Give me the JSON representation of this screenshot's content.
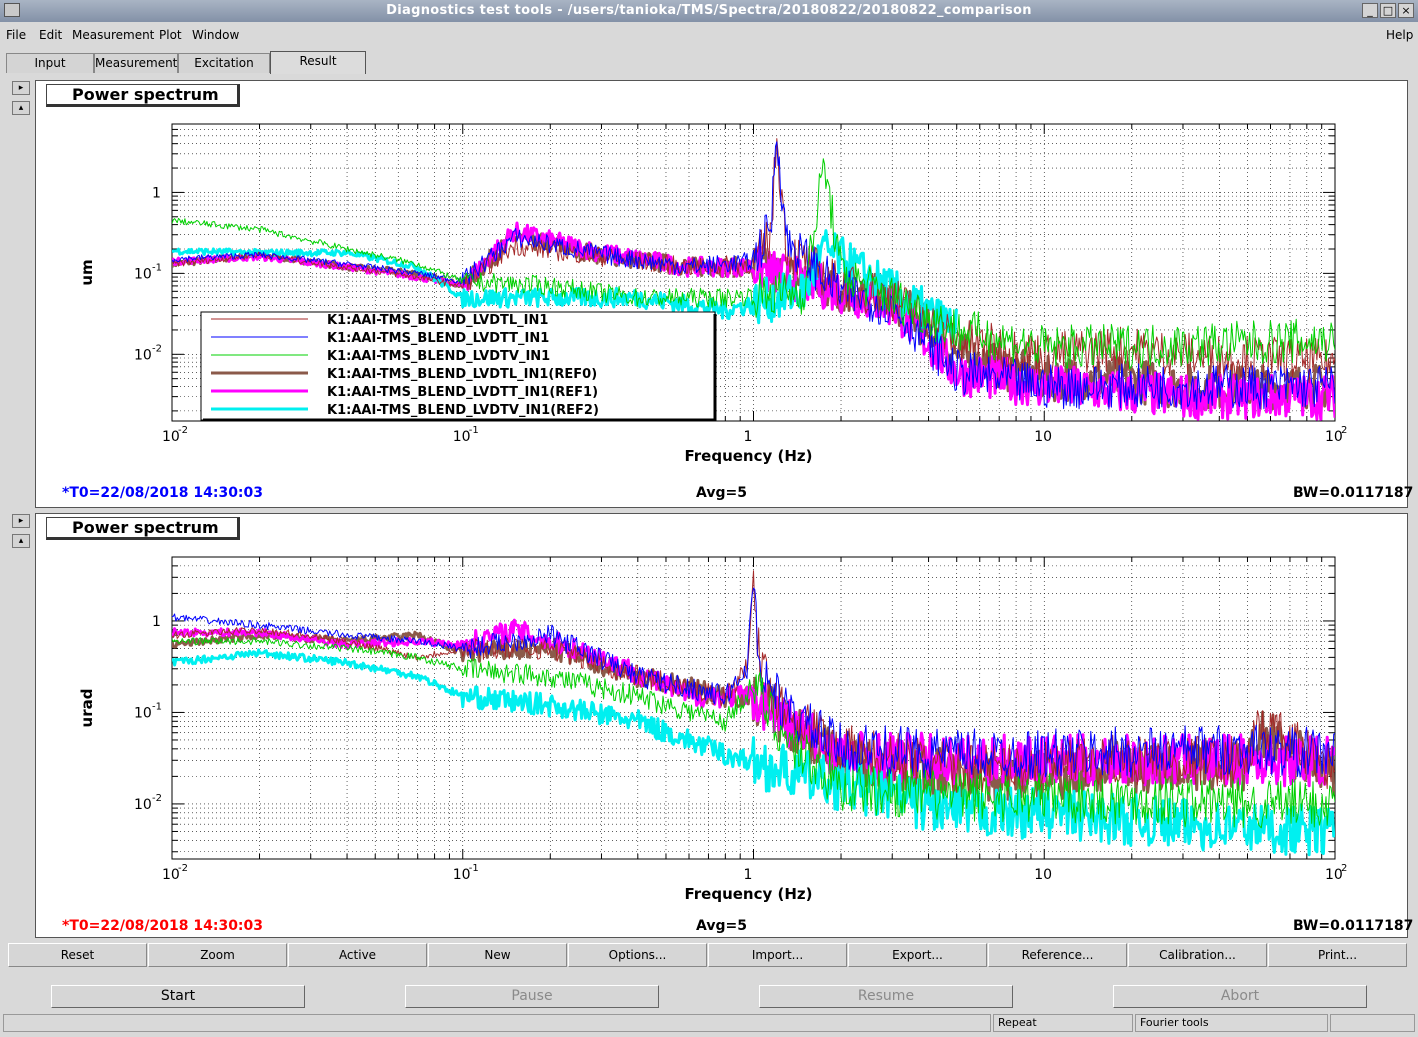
{
  "window": {
    "title": "Diagnostics test tools - /users/tanioka/TMS/Spectra/20180822/20180822_comparison"
  },
  "menubar": {
    "file": "File",
    "edit": "Edit",
    "measurement": "Measurement",
    "plot": "Plot",
    "window": "Window",
    "help": "Help"
  },
  "tabs": [
    "Input",
    "Measurement",
    "Excitation",
    "Result"
  ],
  "colors": {
    "trace0": "#a52a2a",
    "trace1": "#0000ff",
    "trace2": "#00d000",
    "ref0": "#8b5a4a",
    "ref1": "#ff00ff",
    "ref2": "#00f0f0",
    "red": "#ff0000",
    "t0_top": "#0000ff",
    "t0_bottom": "#ff0000"
  },
  "plots": [
    {
      "title": "Power spectrum",
      "ylabel": "um",
      "xlabel": "Frequency (Hz)",
      "t0": "*T0=22/08/2018 14:30:03",
      "avg": "Avg=5",
      "bw": "BW=0.0117187",
      "xticks": [
        "10",
        "10",
        "1",
        "10",
        "10"
      ],
      "xticks_exp": [
        "-2",
        "-1",
        "",
        "",
        "2"
      ],
      "yticks": [
        "1",
        "10",
        "10"
      ],
      "yticks_exp": [
        "",
        "-1",
        "-2"
      ]
    },
    {
      "title": "Power spectrum",
      "ylabel": "urad",
      "xlabel": "Frequency (Hz)",
      "t0": "*T0=22/08/2018 14:30:03",
      "avg": "Avg=5",
      "bw": "BW=0.0117187",
      "xticks": [
        "10",
        "10",
        "1",
        "10",
        "10"
      ],
      "xticks_exp": [
        "-2",
        "-1",
        "",
        "",
        "2"
      ],
      "yticks": [
        "1",
        "10",
        "10"
      ],
      "yticks_exp": [
        "",
        "-1",
        "-2"
      ]
    }
  ],
  "legend": [
    "K1:AAI-TMS_BLEND_LVDTL_IN1",
    "K1:AAI-TMS_BLEND_LVDTT_IN1",
    "K1:AAI-TMS_BLEND_LVDTV_IN1",
    "K1:AAI-TMS_BLEND_LVDTL_IN1(REF0)",
    "K1:AAI-TMS_BLEND_LVDTT_IN1(REF1)",
    "K1:AAI-TMS_BLEND_LVDTV_IN1(REF2)"
  ],
  "toolbar": [
    "Reset",
    "Zoom",
    "Active",
    "New",
    "Options...",
    "Import...",
    "Export...",
    "Reference...",
    "Calibration...",
    "Print..."
  ],
  "controls": {
    "start": "Start",
    "pause": "Pause",
    "resume": "Resume",
    "abort": "Abort"
  },
  "statusbar": {
    "repeat": "Repeat",
    "fourier": "Fourier tools"
  },
  "chart_data": [
    {
      "type": "line",
      "title": "Power spectrum",
      "xlabel": "Frequency (Hz)",
      "ylabel": "um",
      "xscale": "log",
      "yscale": "log",
      "xlim": [
        0.01,
        100
      ],
      "ylim": [
        0.0015,
        7
      ],
      "grid": true,
      "legend_position": "lower-left",
      "series": [
        {
          "name": "K1:AAI-TMS_BLEND_LVDTL_IN1",
          "x": [
            0.01,
            0.02,
            0.04,
            0.07,
            0.1,
            0.15,
            0.3,
            0.6,
            1,
            1.15,
            1.2,
            1.3,
            2,
            3,
            5,
            10,
            18,
            30,
            100
          ],
          "y": [
            0.13,
            0.17,
            0.12,
            0.09,
            0.07,
            0.22,
            0.16,
            0.12,
            0.13,
            0.3,
            5,
            0.2,
            0.07,
            0.05,
            0.015,
            0.01,
            0.012,
            0.01,
            0.008
          ]
        },
        {
          "name": "K1:AAI-TMS_BLEND_LVDTT_IN1",
          "x": [
            0.01,
            0.02,
            0.04,
            0.07,
            0.1,
            0.15,
            0.3,
            0.6,
            1,
            1.15,
            1.2,
            1.3,
            2,
            3,
            5,
            10,
            30,
            100
          ],
          "y": [
            0.15,
            0.17,
            0.13,
            0.1,
            0.08,
            0.28,
            0.17,
            0.12,
            0.14,
            0.4,
            6,
            0.25,
            0.06,
            0.04,
            0.006,
            0.004,
            0.004,
            0.004
          ]
        },
        {
          "name": "K1:AAI-TMS_BLEND_LVDTV_IN1",
          "x": [
            0.01,
            0.02,
            0.04,
            0.07,
            0.1,
            0.2,
            0.4,
            0.8,
            1.5,
            1.75,
            2,
            3,
            5,
            10,
            30,
            100
          ],
          "y": [
            0.45,
            0.35,
            0.2,
            0.13,
            0.08,
            0.07,
            0.05,
            0.05,
            0.06,
            2.3,
            0.1,
            0.05,
            0.02,
            0.012,
            0.013,
            0.015
          ]
        },
        {
          "name": "K1:AAI-TMS_BLEND_LVDTL_IN1(REF0)",
          "x": [
            0.01,
            0.02,
            0.04,
            0.07,
            0.1,
            0.15,
            0.3,
            0.6,
            1,
            2,
            3,
            5,
            10,
            18,
            30,
            100
          ],
          "y": [
            0.13,
            0.17,
            0.12,
            0.1,
            0.07,
            0.28,
            0.17,
            0.12,
            0.12,
            0.06,
            0.05,
            0.01,
            0.005,
            0.005,
            0.004,
            0.004
          ]
        },
        {
          "name": "K1:AAI-TMS_BLEND_LVDTT_IN1(REF1)",
          "x": [
            0.01,
            0.02,
            0.04,
            0.07,
            0.1,
            0.15,
            0.3,
            0.6,
            1,
            2,
            3,
            5,
            10,
            30,
            100
          ],
          "y": [
            0.14,
            0.16,
            0.12,
            0.09,
            0.07,
            0.33,
            0.18,
            0.12,
            0.12,
            0.06,
            0.04,
            0.006,
            0.004,
            0.003,
            0.003
          ]
        },
        {
          "name": "K1:AAI-TMS_BLEND_LVDTV_IN1(REF2)",
          "x": [
            0.01,
            0.02,
            0.04,
            0.07,
            0.1,
            0.2,
            0.4,
            0.8,
            1.5,
            1.75,
            2,
            3,
            5
          ],
          "y": [
            0.19,
            0.18,
            0.18,
            0.12,
            0.05,
            0.05,
            0.05,
            0.035,
            0.06,
            0.2,
            0.15,
            0.06,
            0.02
          ]
        }
      ]
    },
    {
      "type": "line",
      "title": "Power spectrum",
      "xlabel": "Frequency (Hz)",
      "ylabel": "urad",
      "xscale": "log",
      "yscale": "log",
      "xlim": [
        0.01,
        100
      ],
      "ylim": [
        0.0025,
        5
      ],
      "grid": true,
      "series": [
        {
          "name": "K1:AAI-TMS_BLEND_LVDTL_IN1",
          "x": [
            0.01,
            0.02,
            0.04,
            0.07,
            0.1,
            0.2,
            0.4,
            0.8,
            0.95,
            1,
            1.05,
            1.3,
            2,
            5,
            10,
            18,
            50,
            55,
            100
          ],
          "y": [
            0.7,
            0.8,
            0.6,
            0.4,
            0.5,
            0.5,
            0.25,
            0.15,
            0.3,
            4,
            0.3,
            0.1,
            0.04,
            0.025,
            0.025,
            0.03,
            0.03,
            0.07,
            0.025
          ]
        },
        {
          "name": "K1:AAI-TMS_BLEND_LVDTT_IN1",
          "x": [
            0.01,
            0.02,
            0.04,
            0.07,
            0.1,
            0.2,
            0.4,
            0.8,
            0.95,
            1,
            1.05,
            1.3,
            2,
            5,
            10,
            50,
            100
          ],
          "y": [
            1.1,
            0.9,
            0.7,
            0.6,
            0.5,
            0.7,
            0.25,
            0.15,
            0.3,
            3,
            0.3,
            0.1,
            0.04,
            0.035,
            0.035,
            0.04,
            0.035
          ]
        },
        {
          "name": "K1:AAI-TMS_BLEND_LVDTV_IN1",
          "x": [
            0.01,
            0.02,
            0.04,
            0.07,
            0.1,
            0.2,
            0.4,
            0.8,
            1,
            1.3,
            2,
            5,
            10,
            50,
            100
          ],
          "y": [
            0.6,
            0.6,
            0.5,
            0.4,
            0.3,
            0.25,
            0.15,
            0.08,
            0.2,
            0.05,
            0.015,
            0.012,
            0.012,
            0.01,
            0.01
          ]
        },
        {
          "name": "K1:AAI-TMS_BLEND_LVDTL_IN1(REF0)",
          "x": [
            0.01,
            0.02,
            0.04,
            0.07,
            0.1,
            0.2,
            0.4,
            0.8,
            1,
            1.3,
            2,
            5,
            10,
            18,
            50,
            55,
            100
          ],
          "y": [
            0.55,
            0.7,
            0.6,
            0.7,
            0.45,
            0.5,
            0.25,
            0.15,
            0.15,
            0.08,
            0.03,
            0.02,
            0.02,
            0.025,
            0.025,
            0.06,
            0.02
          ]
        },
        {
          "name": "K1:AAI-TMS_BLEND_LVDTT_IN1(REF1)",
          "x": [
            0.01,
            0.02,
            0.04,
            0.07,
            0.1,
            0.15,
            0.3,
            0.6,
            1,
            1.3,
            2,
            5,
            10,
            100
          ],
          "y": [
            0.75,
            0.75,
            0.55,
            0.6,
            0.55,
            0.8,
            0.4,
            0.15,
            0.15,
            0.08,
            0.035,
            0.03,
            0.03,
            0.03
          ]
        },
        {
          "name": "K1:AAI-TMS_BLEND_LVDTV_IN1(REF2)",
          "x": [
            0.01,
            0.02,
            0.04,
            0.07,
            0.1,
            0.2,
            0.4,
            0.8,
            1.5,
            3,
            5,
            10,
            30,
            100
          ],
          "y": [
            0.35,
            0.45,
            0.35,
            0.25,
            0.15,
            0.12,
            0.08,
            0.035,
            0.02,
            0.012,
            0.008,
            0.008,
            0.006,
            0.005
          ]
        }
      ]
    }
  ]
}
